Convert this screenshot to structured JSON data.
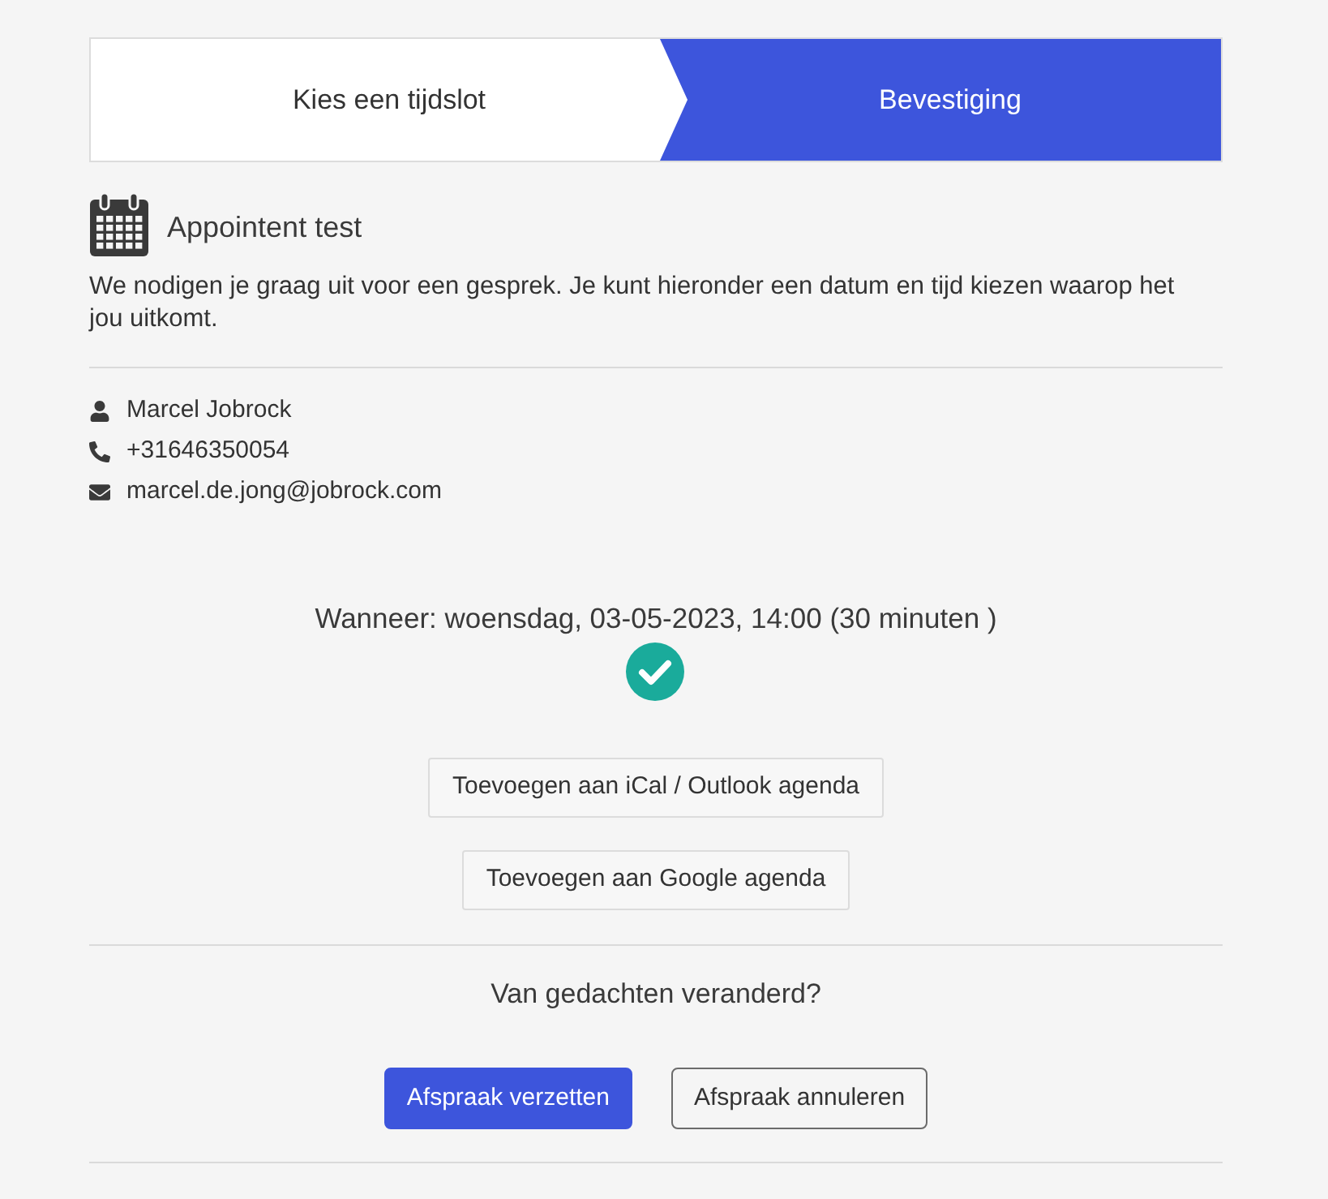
{
  "steps": [
    {
      "label": "Kies een tijdslot",
      "selected": false
    },
    {
      "label": "Bevestiging",
      "selected": true
    }
  ],
  "appointment": {
    "title": "Appointent test",
    "description": "We nodigen je graag uit voor een gesprek. Je kunt hieronder een datum en tijd kiezen waarop het jou uitkomt."
  },
  "contact": [
    {
      "kind": "person",
      "text": "Marcel Jobrock"
    },
    {
      "kind": "phone",
      "text": "+31646350054"
    },
    {
      "kind": "email",
      "text": "marcel.de.jong@jobrock.com"
    }
  ],
  "confirmation": {
    "when": "Wanneer: woensdag, 03-05-2023, 14:00 (30 minuten )",
    "confirmed": true
  },
  "calendar_buttons": [
    "Toevoegen aan iCal / Outlook agenda",
    "Toevoegen aan Google agenda"
  ],
  "change": {
    "question": "Van gedachten veranderd?",
    "actions": [
      {
        "label": "Afspraak verzetten",
        "kind": "primary"
      },
      {
        "label": "Afspraak annuleren",
        "kind": "secondary"
      }
    ]
  }
}
